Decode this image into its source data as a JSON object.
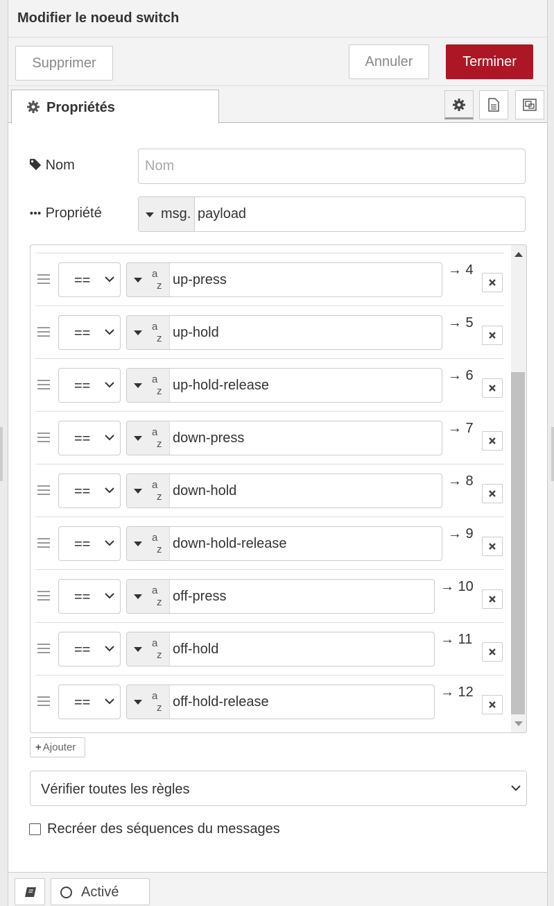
{
  "dialog": {
    "title": "Modifier le noeud switch",
    "delete_label": "Supprimer",
    "cancel_label": "Annuler",
    "done_label": "Terminer",
    "accent": "#ad1625"
  },
  "tabs": {
    "properties_label": "Propriétés",
    "icons": [
      "gear-icon",
      "document-icon",
      "layout-icon"
    ]
  },
  "form": {
    "name_label": "Nom",
    "name_value": "",
    "name_placeholder": "Nom",
    "property_label": "Propriété",
    "property_prefix": "msg.",
    "property_value": "payload"
  },
  "rules": [
    {
      "operator": "==",
      "type": "az",
      "value": "up-press",
      "output": "→ 4"
    },
    {
      "operator": "==",
      "type": "az",
      "value": "up-hold",
      "output": "→ 5"
    },
    {
      "operator": "==",
      "type": "az",
      "value": "up-hold-release",
      "output": "→ 6"
    },
    {
      "operator": "==",
      "type": "az",
      "value": "down-press",
      "output": "→ 7"
    },
    {
      "operator": "==",
      "type": "az",
      "value": "down-hold",
      "output": "→ 8"
    },
    {
      "operator": "==",
      "type": "az",
      "value": "down-hold-release",
      "output": "→ 9"
    },
    {
      "operator": "==",
      "type": "az",
      "value": "off-press",
      "output": "→ 10"
    },
    {
      "operator": "==",
      "type": "az",
      "value": "off-hold",
      "output": "→ 11"
    },
    {
      "operator": "==",
      "type": "az",
      "value": "off-hold-release",
      "output": "→ 12"
    }
  ],
  "add_label": "Ajouter",
  "check_mode": "Vérifier toutes les règles",
  "recreate_label": "Recréer des séquences du messages",
  "recreate_checked": false,
  "footer": {
    "enabled_label": "Activé"
  }
}
